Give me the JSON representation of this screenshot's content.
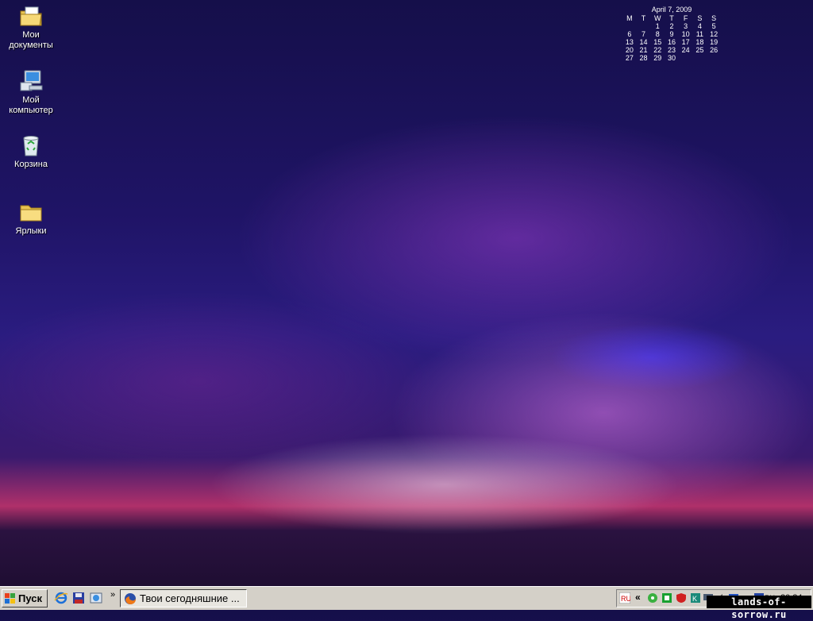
{
  "desktop": {
    "icons": [
      {
        "label": "Мои документы",
        "icon": "my-documents-icon"
      },
      {
        "label": "Мой компьютер",
        "icon": "my-computer-icon"
      },
      {
        "label": "Корзина",
        "icon": "recycle-bin-icon"
      },
      {
        "label": "Ярлыки",
        "icon": "folder-icon"
      }
    ]
  },
  "calendar": {
    "title": "April 7, 2009",
    "weekdays": [
      "M",
      "T",
      "W",
      "T",
      "F",
      "S",
      "S"
    ],
    "weeks": [
      [
        "",
        "",
        "1",
        "2",
        "3",
        "4",
        "5"
      ],
      [
        "6",
        "7",
        "8",
        "9",
        "10",
        "11",
        "12"
      ],
      [
        "13",
        "14",
        "15",
        "16",
        "17",
        "18",
        "19"
      ],
      [
        "20",
        "21",
        "22",
        "23",
        "24",
        "25",
        "26"
      ],
      [
        "27",
        "28",
        "29",
        "30",
        "",
        "",
        ""
      ]
    ]
  },
  "taskbar": {
    "start_label": "Пуск",
    "quick_launch": [
      "internet-explorer-icon",
      "save-disk-icon",
      "explorer-icon"
    ],
    "chevron": "»",
    "task_button_label": "Твои сегодняшние ...",
    "tray": {
      "collapse_arrow": "«",
      "icons": [
        "language-ru-icon",
        "network-icon",
        "green-app-icon",
        "shield-icon",
        "kaspersky-icon",
        "monitor-icon",
        "volume-icon",
        "display-icon",
        "folder-tray-icon",
        "tray-app-icon"
      ],
      "lang_label": "RU",
      "clock": "20:24"
    }
  },
  "watermark": "lands-of-sorrow.ru"
}
